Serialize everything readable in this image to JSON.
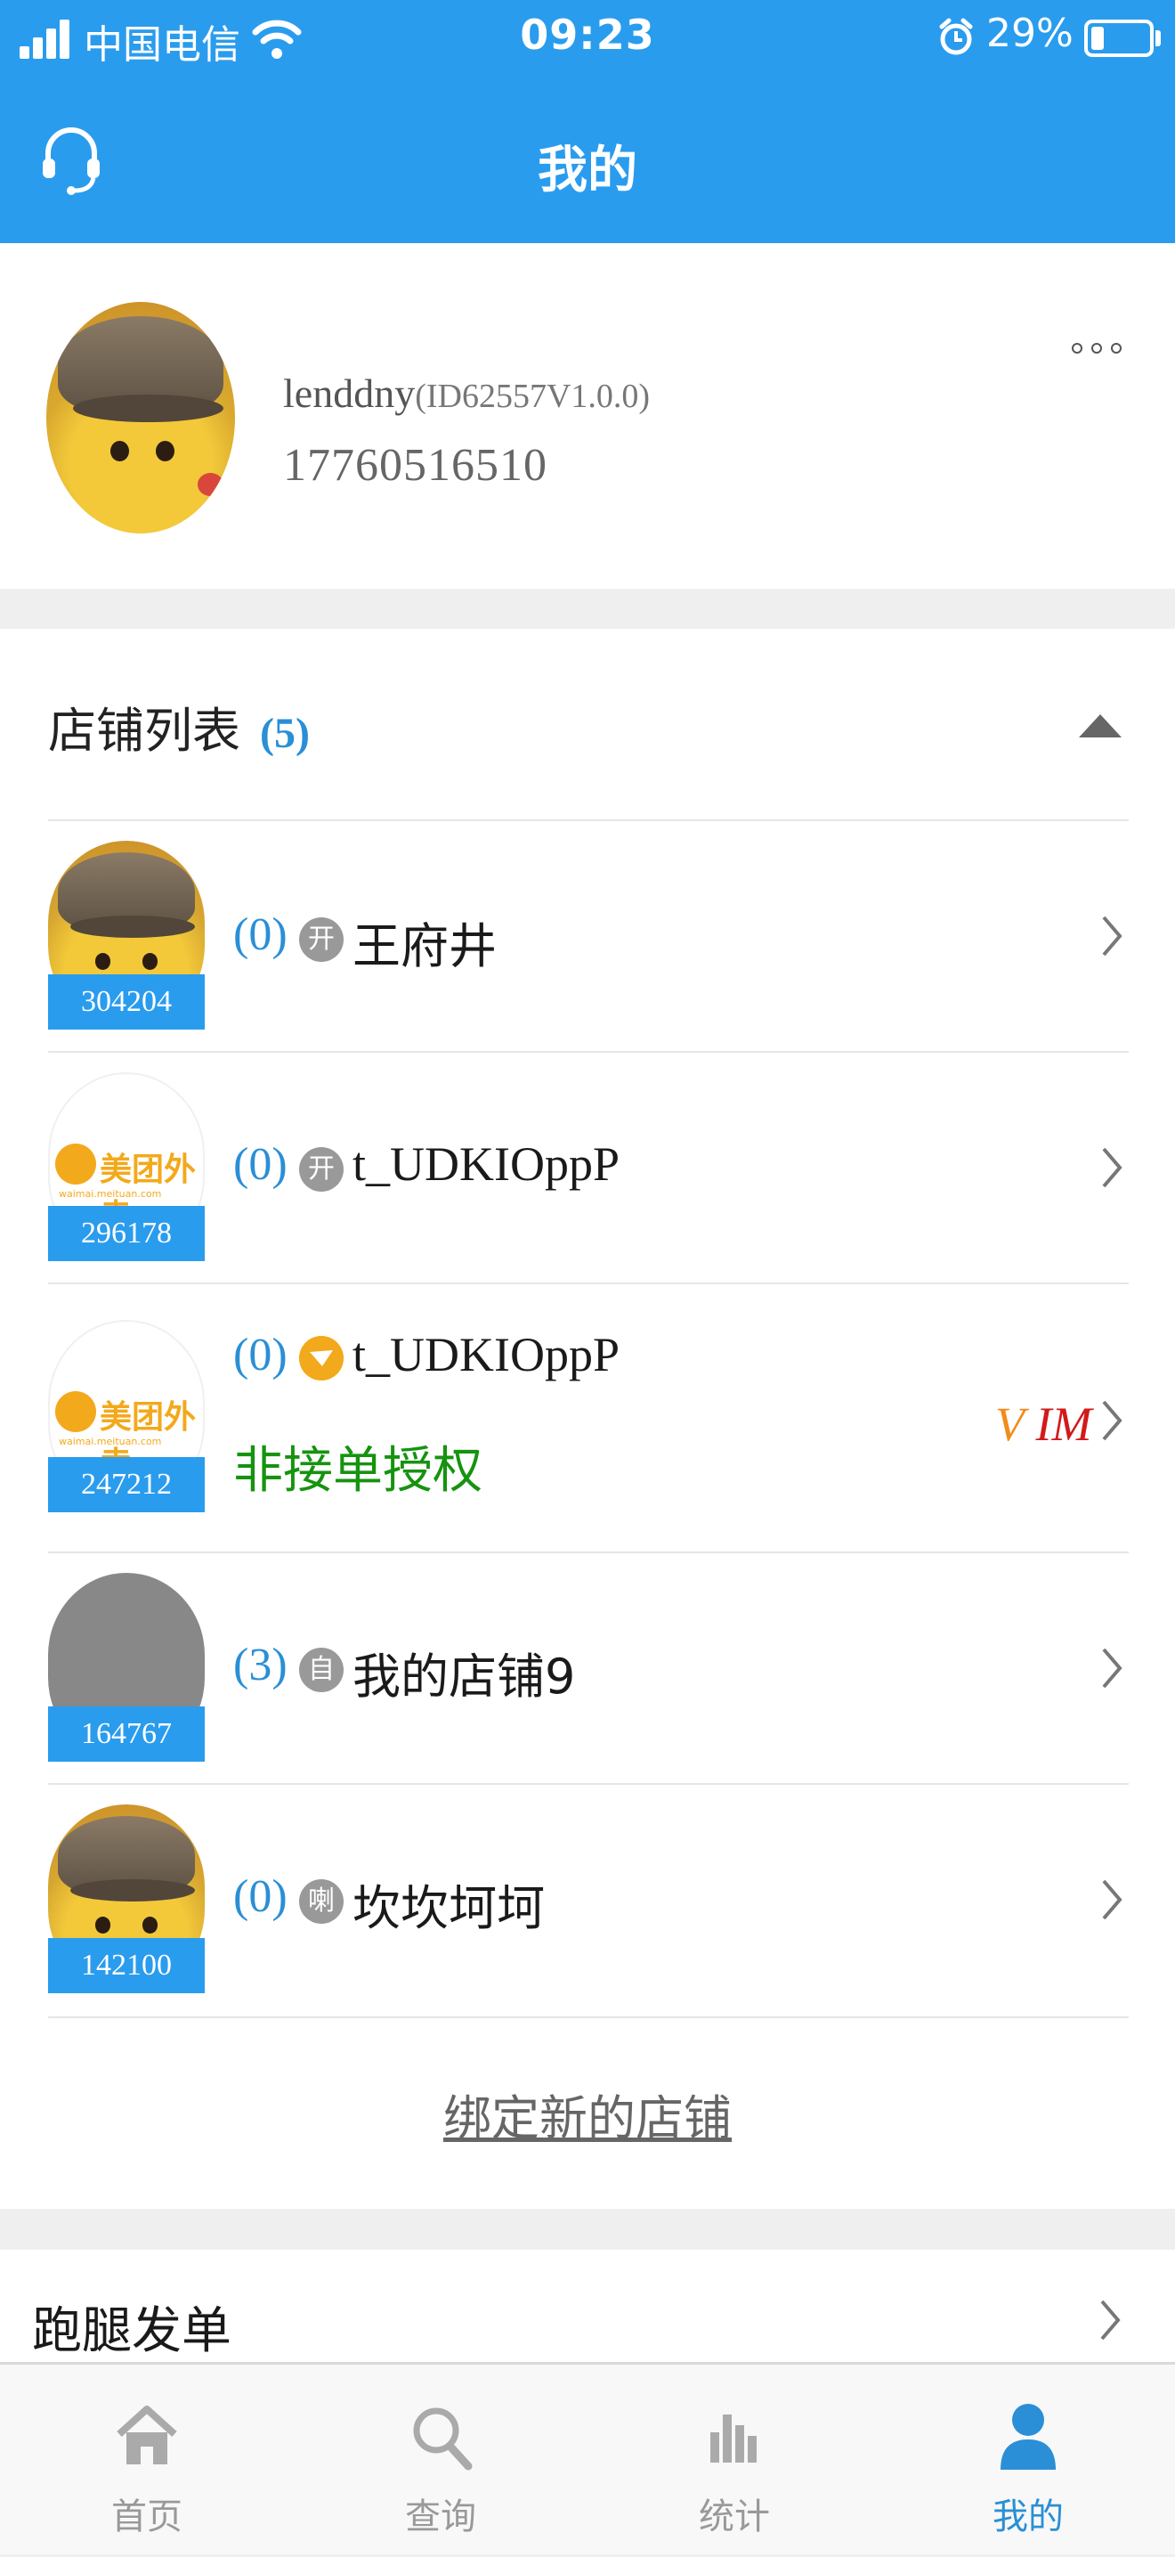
{
  "status_bar": {
    "carrier": "中国电信",
    "time": "09:23",
    "battery_pct": "29%"
  },
  "nav": {
    "title": "我的"
  },
  "profile": {
    "username": "lenddny",
    "id_version": "(ID62557V1.0.0)",
    "phone": "17760516510"
  },
  "shops": {
    "header": "店铺列表",
    "count": "(5)",
    "items": [
      {
        "id": "304204",
        "count": "(0)",
        "badge": "开",
        "name": "王府井",
        "avatar": "pikachu"
      },
      {
        "id": "296178",
        "count": "(0)",
        "badge": "开",
        "name": "t_UDKIOppP",
        "avatar": "meituan"
      },
      {
        "id": "247212",
        "count": "(0)",
        "badge": "",
        "name": "t_UDKIOppP",
        "avatar": "meituan",
        "auth": "非接单授权",
        "tag_v": "V",
        "tag_im": "IM"
      },
      {
        "id": "164767",
        "count": "(3)",
        "badge": "自",
        "name": "我的店铺9",
        "avatar": "gray"
      },
      {
        "id": "142100",
        "count": "(0)",
        "badge": "喇",
        "name": "坎坎坷坷",
        "avatar": "pikachu"
      }
    ],
    "meituan_logo_text": "美团外卖",
    "meituan_logo_url": "waimai.meituan.com",
    "bind_new": "绑定新的店铺"
  },
  "paotui": {
    "label": "跑腿发单"
  },
  "tabs": [
    {
      "label": "首页",
      "icon": "home-icon",
      "active": false
    },
    {
      "label": "查询",
      "icon": "search-icon",
      "active": false
    },
    {
      "label": "统计",
      "icon": "stats-icon",
      "active": false
    },
    {
      "label": "我的",
      "icon": "user-icon",
      "active": true
    }
  ],
  "colors": {
    "primary": "#2a9cee",
    "auth_green": "#16930f",
    "vim_orange": "#f08c1a",
    "vim_red": "#d21a1a",
    "meituan": "#f3a91c"
  }
}
